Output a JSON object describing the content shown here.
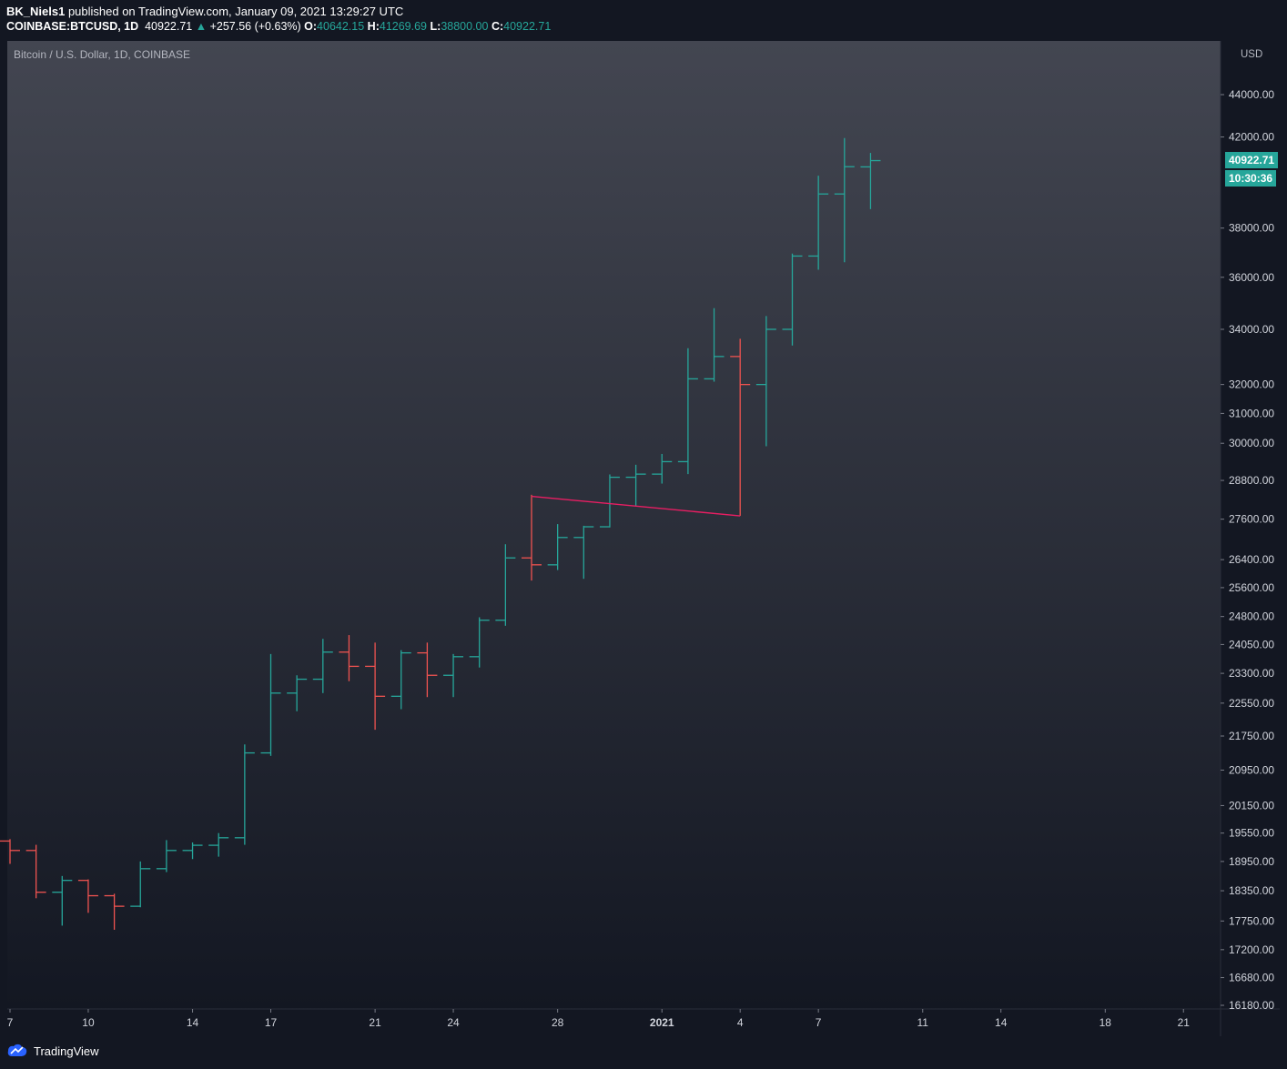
{
  "header": {
    "author": "BK_Niels1",
    "published_text": "published on TradingView.com, January 09, 2021 13:29:27 UTC",
    "symbol": "COINBASE:BTCUSD, 1D",
    "last": "40922.71",
    "change": "+257.56 (+0.63%)",
    "o_label": "O:",
    "o_value": "40642.15",
    "h_label": "H:",
    "h_value": "41269.69",
    "l_label": "L:",
    "l_value": "38800.00",
    "c_label": "C:",
    "c_value": "40922.71"
  },
  "chart_title": "Bitcoin / U.S. Dollar, 1D, COINBASE",
  "currency": "USD",
  "price_tag": "40922.71",
  "countdown_tag": "10:30:36",
  "footer": {
    "brand": "TradingView"
  },
  "colors": {
    "up": "#26a69a",
    "down": "#ef5350",
    "line": "#e91e63",
    "background_top": "#434651",
    "background_bottom": "#131722"
  },
  "chart_data": {
    "type": "ohlc",
    "scale": "log",
    "y_ticks": [
      "44000.00",
      "42000.00",
      "38000.00",
      "36000.00",
      "34000.00",
      "32000.00",
      "31000.00",
      "30000.00",
      "28800.00",
      "27600.00",
      "26400.00",
      "25600.00",
      "24800.00",
      "24050.00",
      "23300.00",
      "22550.00",
      "21750.00",
      "20950.00",
      "20150.00",
      "19550.00",
      "18950.00",
      "18350.00",
      "17750.00",
      "17200.00",
      "16680.00",
      "16180.00"
    ],
    "x_ticks": [
      "7",
      "10",
      "14",
      "17",
      "21",
      "24",
      "28",
      "2021",
      "4",
      "7",
      "11",
      "14",
      "18",
      "21"
    ],
    "bars": [
      {
        "date": "2020-12-07",
        "o": 19380,
        "h": 19420,
        "l": 18900,
        "c": 19180
      },
      {
        "date": "2020-12-08",
        "o": 19180,
        "h": 19300,
        "l": 18200,
        "c": 18320
      },
      {
        "date": "2020-12-09",
        "o": 18320,
        "h": 18650,
        "l": 17660,
        "c": 18560
      },
      {
        "date": "2020-12-10",
        "o": 18560,
        "h": 18580,
        "l": 17910,
        "c": 18250
      },
      {
        "date": "2020-12-11",
        "o": 18250,
        "h": 18290,
        "l": 17580,
        "c": 18040
      },
      {
        "date": "2020-12-12",
        "o": 18040,
        "h": 18950,
        "l": 18020,
        "c": 18800
      },
      {
        "date": "2020-12-13",
        "o": 18800,
        "h": 19400,
        "l": 18730,
        "c": 19180
      },
      {
        "date": "2020-12-14",
        "o": 19180,
        "h": 19350,
        "l": 19000,
        "c": 19290
      },
      {
        "date": "2020-12-15",
        "o": 19290,
        "h": 19550,
        "l": 19050,
        "c": 19450
      },
      {
        "date": "2020-12-16",
        "o": 19450,
        "h": 21550,
        "l": 19300,
        "c": 21350
      },
      {
        "date": "2020-12-17",
        "o": 21350,
        "h": 23800,
        "l": 21280,
        "c": 22800
      },
      {
        "date": "2020-12-18",
        "o": 22800,
        "h": 23250,
        "l": 22350,
        "c": 23150
      },
      {
        "date": "2020-12-19",
        "o": 23150,
        "h": 24200,
        "l": 22800,
        "c": 23850
      },
      {
        "date": "2020-12-20",
        "o": 23850,
        "h": 24300,
        "l": 23100,
        "c": 23480
      },
      {
        "date": "2020-12-21",
        "o": 23480,
        "h": 24100,
        "l": 21900,
        "c": 22720
      },
      {
        "date": "2020-12-22",
        "o": 22720,
        "h": 23900,
        "l": 22400,
        "c": 23830
      },
      {
        "date": "2020-12-23",
        "o": 23830,
        "h": 24100,
        "l": 22700,
        "c": 23250
      },
      {
        "date": "2020-12-24",
        "o": 23250,
        "h": 23800,
        "l": 22700,
        "c": 23730
      },
      {
        "date": "2020-12-25",
        "o": 23730,
        "h": 24780,
        "l": 23450,
        "c": 24700
      },
      {
        "date": "2020-12-26",
        "o": 24700,
        "h": 26850,
        "l": 24550,
        "c": 26450
      },
      {
        "date": "2020-12-27",
        "o": 26450,
        "h": 28350,
        "l": 25800,
        "c": 26250
      },
      {
        "date": "2020-12-28",
        "o": 26250,
        "h": 27450,
        "l": 26100,
        "c": 27050
      },
      {
        "date": "2020-12-29",
        "o": 27050,
        "h": 27400,
        "l": 25850,
        "c": 27370
      },
      {
        "date": "2020-12-30",
        "o": 27370,
        "h": 28990,
        "l": 27350,
        "c": 28900
      },
      {
        "date": "2020-12-31",
        "o": 28900,
        "h": 29300,
        "l": 28000,
        "c": 29000
      },
      {
        "date": "2021-01-01",
        "o": 29000,
        "h": 29650,
        "l": 28700,
        "c": 29400
      },
      {
        "date": "2021-01-02",
        "o": 29400,
        "h": 33300,
        "l": 29000,
        "c": 32200
      },
      {
        "date": "2021-01-03",
        "o": 32200,
        "h": 34800,
        "l": 32100,
        "c": 33000
      },
      {
        "date": "2021-01-04",
        "o": 33000,
        "h": 33650,
        "l": 27700,
        "c": 32000
      },
      {
        "date": "2021-01-05",
        "o": 32000,
        "h": 34500,
        "l": 29900,
        "c": 34000
      },
      {
        "date": "2021-01-06",
        "o": 34000,
        "h": 36950,
        "l": 33400,
        "c": 36850
      },
      {
        "date": "2021-01-07",
        "o": 36850,
        "h": 40250,
        "l": 36300,
        "c": 39450
      },
      {
        "date": "2021-01-08",
        "o": 39450,
        "h": 41950,
        "l": 36600,
        "c": 40650
      },
      {
        "date": "2021-01-09",
        "o": 40642.15,
        "h": 41269.69,
        "l": 38800,
        "c": 40922.71
      }
    ],
    "trendline": [
      {
        "date": "2020-12-27",
        "price": 28300
      },
      {
        "date": "2021-01-04",
        "price": 27700
      }
    ]
  }
}
